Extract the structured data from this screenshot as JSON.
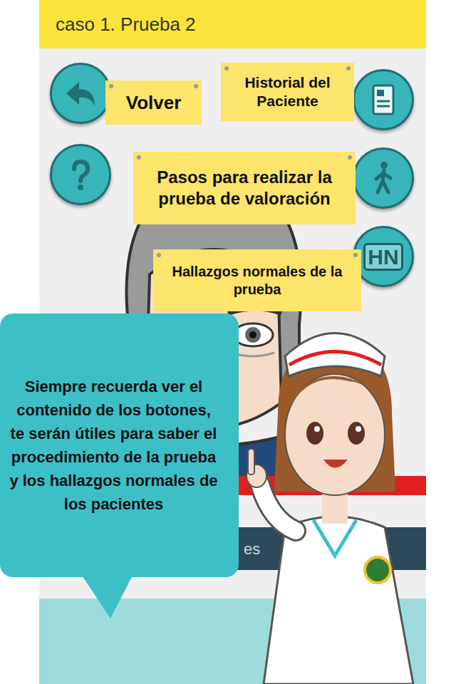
{
  "header": {
    "title": "caso 1. Prueba 2"
  },
  "side_buttons": {
    "hn_label": "HN"
  },
  "tutorial_labels": [
    "Volver",
    "Historial del Paciente",
    "Pasos para realizar la prueba de valoración",
    "Hallazgos normales  de la prueba"
  ],
  "bubble": {
    "text": "Siempre recuerda ver el contenido de los botones, te serán útiles para saber el procedimiento de la prueba\ny los hallazgos normales de los pacientes"
  },
  "app_partial_button": "es"
}
